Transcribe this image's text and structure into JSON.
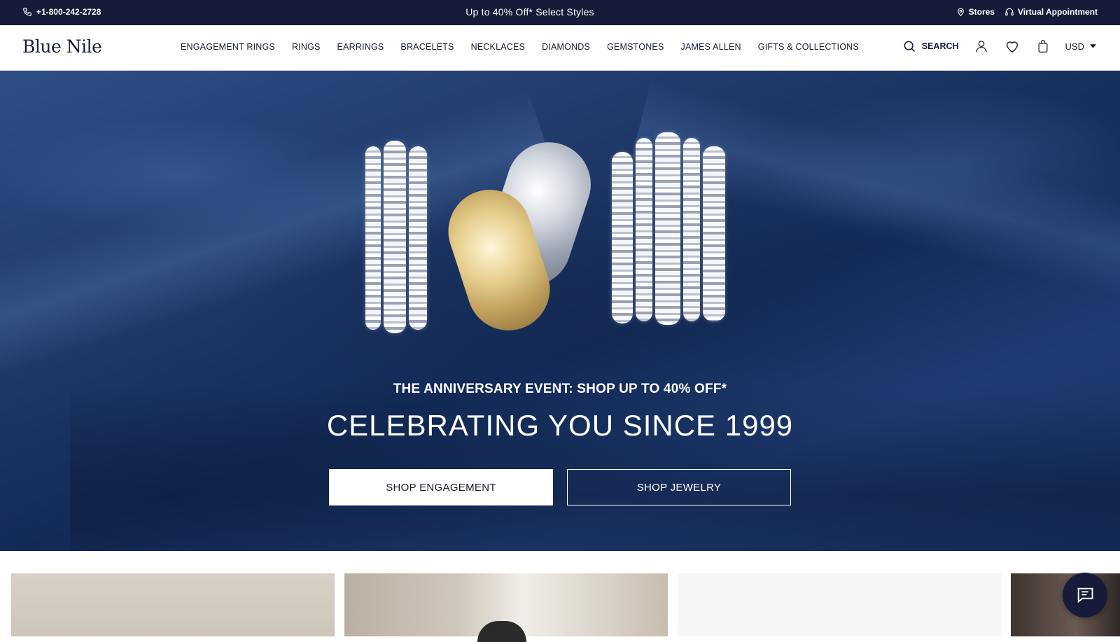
{
  "topbar": {
    "phone": "+1-800-242-2728",
    "promo": "Up to 40% Off* Select Styles",
    "stores": "Stores",
    "virtual": "Virtual Appointment"
  },
  "header": {
    "logo": "Blue Nile",
    "nav": [
      "ENGAGEMENT RINGS",
      "RINGS",
      "EARRINGS",
      "BRACELETS",
      "NECKLACES",
      "DIAMONDS",
      "GEMSTONES",
      "JAMES ALLEN",
      "GIFTS & COLLECTIONS"
    ],
    "search_label": "SEARCH",
    "currency": "USD",
    "icons": [
      "search-icon",
      "account-icon",
      "wishlist-heart-icon",
      "shopping-bag-icon",
      "caret-down-icon"
    ]
  },
  "hero": {
    "subtitle": "THE ANNIVERSARY EVENT: SHOP UP TO 40% OFF*",
    "title": "CELEBRATING YOU SINCE 1999",
    "btn_engagement": "SHOP ENGAGEMENT",
    "btn_jewelry": "SHOP JEWELRY"
  },
  "colors": {
    "navy": "#151b38",
    "hero_blue": "#1e3766",
    "white": "#ffffff"
  },
  "chat": {
    "icon": "chat-bubble-icon"
  }
}
